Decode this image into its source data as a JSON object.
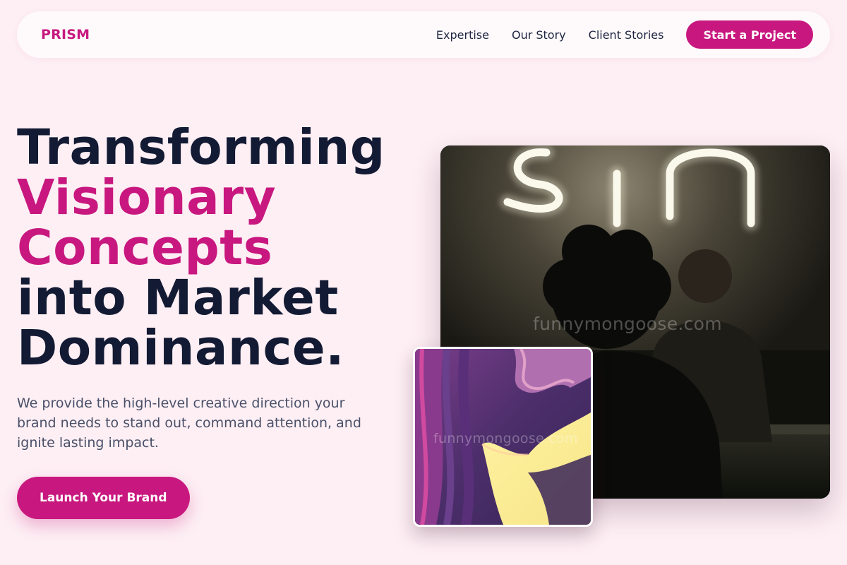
{
  "brand": {
    "logo": "PRISM"
  },
  "nav": {
    "links": [
      "Expertise",
      "Our Story",
      "Client Stories"
    ],
    "cta": "Start a Project"
  },
  "hero": {
    "headline_lines": [
      "Transforming",
      "Visionary",
      "Concepts",
      "into Market",
      "Dominance."
    ],
    "subtext": "We provide the high-level creative direction your brand needs to stand out, command attention, and ignite lasting impact.",
    "cta": "Launch Your Brand"
  },
  "images": {
    "main_watermark": "funnymongoose.com",
    "small_watermark": "funnymongoose.com",
    "main_neon_text": "sin"
  },
  "colors": {
    "accent": "#c8187f",
    "background": "#fdeff4",
    "heading": "#131a33",
    "body_text": "#4a5068"
  }
}
